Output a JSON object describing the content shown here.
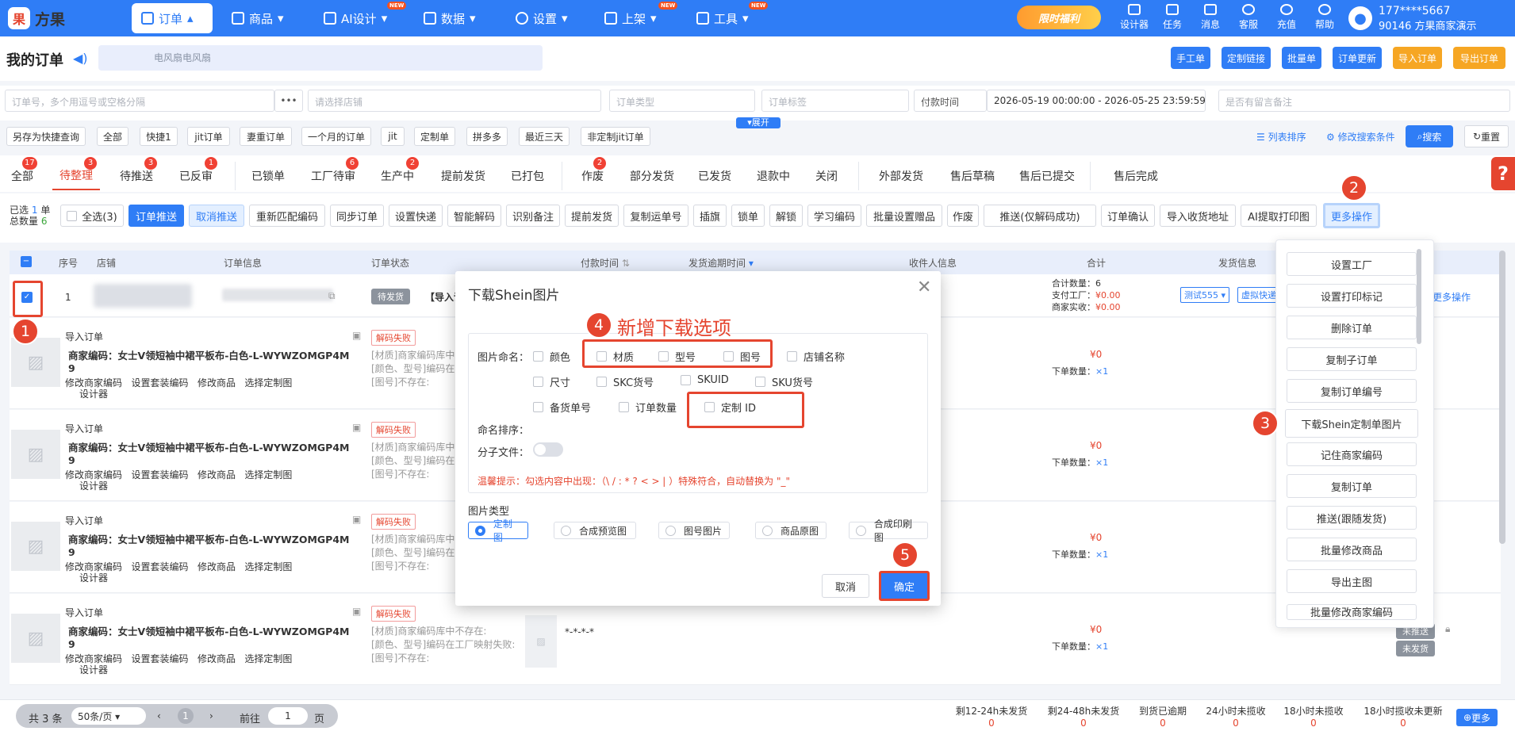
{
  "app": {
    "logo_mark": "果",
    "name": "方果"
  },
  "nav": [
    {
      "label": "订单",
      "icon": "order-icon",
      "new": false
    },
    {
      "label": "商品",
      "icon": "goods-icon",
      "new": false
    },
    {
      "label": "AI设计",
      "icon": "ai-icon",
      "new": true
    },
    {
      "label": "数据",
      "icon": "data-icon",
      "new": false
    },
    {
      "label": "设置",
      "icon": "gear-icon",
      "new": false
    },
    {
      "label": "上架",
      "icon": "upload-icon",
      "new": true
    },
    {
      "label": "工具",
      "icon": "tool-icon",
      "new": true
    }
  ],
  "new_tag": "NEW",
  "promo": "限时福利",
  "tools": [
    "设计器",
    "任务",
    "消息",
    "客服",
    "充值",
    "帮助"
  ],
  "user": {
    "phone": "177****5667",
    "account": "90146 方果商家演示"
  },
  "page": {
    "title": "我的订单",
    "notice": "电风扇电风扇"
  },
  "header_buttons": [
    {
      "label": "手工单",
      "color": "#2f7df6"
    },
    {
      "label": "定制链接",
      "color": "#2f7df6"
    },
    {
      "label": "批量单",
      "color": "#2f7df6"
    },
    {
      "label": "订单更新",
      "color": "#2f7df6"
    },
    {
      "label": "导入订单",
      "color": "#f6a623"
    },
    {
      "label": "导出订单",
      "color": "#f6a623"
    }
  ],
  "filters": {
    "order_no": "订单号，多个用逗号或空格分隔",
    "more": "•••",
    "shop": "请选择店铺",
    "type": "订单类型",
    "tag": "订单标签",
    "time_type": "付款时间",
    "date_range": "2026-05-19 00:00:00  -  2026-05-25 23:59:59",
    "remark": "是否有留言备注"
  },
  "quick": [
    "另存为快捷查询",
    "全部",
    "快捷1",
    "jit订单",
    "妻重订单",
    "一个月的订单",
    "jit",
    "定制单",
    "拼多多",
    "最近三天",
    "非定制jit订单"
  ],
  "expand": "▾展开",
  "list_sort": "列表排序",
  "modify_search": "修改搜索条件",
  "search": "搜索",
  "reset": "重置",
  "tabs": [
    {
      "label": "全部",
      "badge": "17"
    },
    {
      "label": "待整理",
      "badge": "3"
    },
    {
      "label": "待推送",
      "badge": "3"
    },
    {
      "label": "已反审",
      "badge": "1"
    },
    {
      "label": "已锁单",
      "badge": ""
    },
    {
      "label": "工厂待审",
      "badge": "6"
    },
    {
      "label": "生产中",
      "badge": "2"
    },
    {
      "label": "提前发货",
      "badge": ""
    },
    {
      "label": "已打包",
      "badge": ""
    },
    {
      "label": "作废",
      "badge": "2"
    },
    {
      "label": "部分发货",
      "badge": ""
    },
    {
      "label": "已发货",
      "badge": ""
    },
    {
      "label": "退款中",
      "badge": ""
    },
    {
      "label": "关闭",
      "badge": ""
    },
    {
      "label": "外部发货",
      "badge": ""
    },
    {
      "label": "售后草稿",
      "badge": ""
    },
    {
      "label": "售后已提交",
      "badge": ""
    },
    {
      "label": "售后完成",
      "badge": ""
    }
  ],
  "selection": {
    "selected": "已选 1 单",
    "total": "总数量 6",
    "selected_label": "已选",
    "selected_count": "1",
    "selected_unit": "单",
    "total_label": "总数量",
    "total_count": "6"
  },
  "actions": [
    "全选(3)",
    "订单推送",
    "取消推送",
    "重新匹配编码",
    "同步订单",
    "设置快递",
    "智能解码",
    "识别备注",
    "提前发货",
    "复制运单号",
    "插旗",
    "锁单",
    "解锁",
    "学习编码",
    "批量设置赠品",
    "作废",
    "推送(仅解码成功)",
    "订单确认",
    "导入收货地址",
    "AI提取打印图",
    "更多操作"
  ],
  "columns": [
    "序号",
    "店铺",
    "订单信息",
    "订单状态",
    "付款时间",
    "发货逾期时间",
    "收件人信息",
    "合计",
    "发货信息"
  ],
  "order1": {
    "index": "1",
    "status": "待发货",
    "import_prefix": "【导入订",
    "total_count": "合计数量：6",
    "paid_factory": "支付工厂：",
    "paid_factory_val": "¥0.00",
    "merchant_income": "商家实收：",
    "merchant_income_val": "¥0.00",
    "ship_test": "测试555",
    "ship_virtual": "虚拟快递",
    "more": "更多操作"
  },
  "items": [
    {
      "title": "导入订单",
      "code_label": "商家编码：",
      "code": "女士V领短袖中裙平板布-白色-L-WYWZOMGP4M",
      "code2": "9",
      "status": "解码失败",
      "msg1": "[材质]商家编码库中不存在:",
      "msg2": "[颜色、型号]编码在工厂映射失败:",
      "msg3": "[图号]不存在:",
      "amount": "¥0",
      "qty_label": "下单数量：",
      "qty": "×1"
    },
    {
      "title": "导入订单",
      "code_label": "商家编码：",
      "code": "女士V领短袖中裙平板布-白色-L-WYWZOMGP4M",
      "code2": "9",
      "status": "解码失败",
      "msg1": "[材质]商家编码库中不存在:",
      "msg2": "[颜色、型号]编码在工厂映射失败:",
      "msg3": "[图号]不存在:",
      "amount": "¥0",
      "qty_label": "下单数量：",
      "qty": "×1"
    },
    {
      "title": "导入订单",
      "code_label": "商家编码：",
      "code": "女士V领短袖中裙平板布-白色-L-WYWZOMGP4M",
      "code2": "9",
      "status": "解码失败",
      "msg1": "[材质]商家编码库中不存在:",
      "msg2": "[颜色、型号]编码在工厂映射失败:",
      "msg3": "[图号]不存在:",
      "amount": "¥0",
      "qty_label": "下单数量：",
      "qty": "×1"
    },
    {
      "title": "导入订单",
      "code_label": "商家编码：",
      "code": "女士V领短袖中裙平板布-白色-L-WYWZOMGP4M",
      "code2": "9",
      "status": "解码失败",
      "msg1": "[材质]商家编码库中不存在:",
      "msg2": "[颜色、型号]编码在工厂映射失败:",
      "msg3": "[图号]不存在:",
      "amount": "¥0",
      "qty_label": "下单数量：",
      "qty": "×1",
      "extra": "*-*-*-*"
    }
  ],
  "item_links": [
    "修改商家编码",
    "设置套装编码",
    "修改商品",
    "选择定制图",
    "设计器"
  ],
  "row_tags": {
    "unpushed": "未推送",
    "unshipped": "未发货"
  },
  "menu": [
    "设置工厂",
    "设置打印标记",
    "删除订单",
    "复制子订单",
    "复制订单编号",
    "下载Shein定制单图片",
    "记住商家编码",
    "复制订单",
    "推送(跟随发货)",
    "批量修改商品",
    "导出主图",
    "批量修改商家编码"
  ],
  "modal": {
    "title": "下载Shein图片",
    "naming_label": "图片命名：",
    "row1": [
      "颜色",
      "材质",
      "型号",
      "图号",
      "店铺名称"
    ],
    "row2": [
      "尺寸",
      "SKC货号",
      "SKUID",
      "SKU货号"
    ],
    "row3": [
      "备货单号",
      "订单数量",
      "定制 ID"
    ],
    "sort_label": "命名排序：",
    "subfolder_label": "分子文件：",
    "tip": "温馨提示：勾选内容中出现：（\\ / : * ? < > | ）特殊符合，自动替换为 \"_\"",
    "type_label": "图片类型",
    "types": [
      "定制图",
      "合成预览图",
      "图号图片",
      "商品原图",
      "合成印刷图"
    ],
    "cancel": "取消",
    "confirm": "确定"
  },
  "annotation": "新增下载选项",
  "steps": [
    "1",
    "2",
    "3",
    "4",
    "5"
  ],
  "pager": {
    "total": "共 3 条",
    "size": "50条/页",
    "page": "1",
    "goto": "前往",
    "page_input": "1",
    "page_unit": "页"
  },
  "stats": [
    {
      "label": "剩12-24h未发货",
      "value": "0"
    },
    {
      "label": "剩24-48h未发货",
      "value": "0"
    },
    {
      "label": "到货已逾期",
      "value": "0"
    },
    {
      "label": "24小时未揽收",
      "value": "0"
    },
    {
      "label": "18小时未揽收",
      "value": "0"
    },
    {
      "label": "18小时揽收未更新",
      "value": "0"
    }
  ],
  "more_btn": "更多"
}
